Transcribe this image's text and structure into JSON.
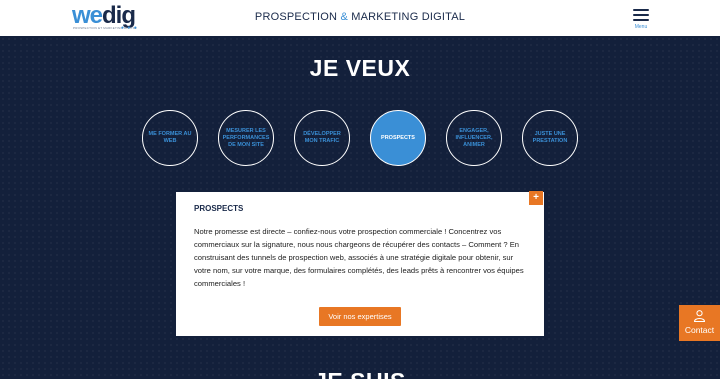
{
  "brand": {
    "logo_prefix": "we",
    "logo_suffix": "dig",
    "logo_tagline": "PROSPECTION ET MARKETING DIGITAL",
    "logo_dots": "● ● ●"
  },
  "header": {
    "title_part1": "PROSPECTION ",
    "title_amp": "&",
    "title_part2": " MARKETING DIGITAL",
    "menu_label": "Menu"
  },
  "section": {
    "heading": "JE VEUX",
    "options": [
      {
        "label": "ME FORMER AU WEB",
        "active": false
      },
      {
        "label": "MESURER LES PERFORMANCES DE MON SITE",
        "active": false
      },
      {
        "label": "DÉVELOPPER MON TRAFIC",
        "active": false
      },
      {
        "label": "PROSPECTS",
        "active": true
      },
      {
        "label": "ENGAGER, INFLUENCER, ANIMER",
        "active": false
      },
      {
        "label": "JUSTE UNE PRESTATION",
        "active": false
      }
    ]
  },
  "card": {
    "plus": "+",
    "title": "PROSPECTS",
    "text": "Notre promesse est directe – confiez-nous votre prospection commerciale ! Concentrez vos commerciaux sur la signature, nous nous chargeons de récupérer des contacts – Comment ? En construisant des tunnels de prospection web, associés à une stratégie digitale pour obtenir, sur votre nom, sur votre marque, des formulaires complétés, des leads prêts à rencontrer vos équipes commerciales !",
    "button": "Voir nos expertises"
  },
  "contact": {
    "label": "Contact",
    "icon": "contact-person-icon"
  },
  "next_section": {
    "heading": "JE SUIS"
  },
  "colors": {
    "navy": "#13203b",
    "accent_blue": "#3a8fd6",
    "orange": "#e87724"
  }
}
